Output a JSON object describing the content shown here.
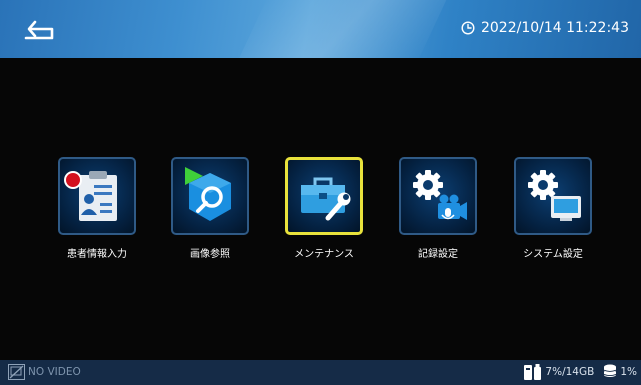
{
  "header": {
    "datetime": "2022/10/14 11:22:43",
    "back_icon": "back-arrow-icon",
    "clock_icon": "clock-icon"
  },
  "menu": {
    "items": [
      {
        "label": "患者情報入力",
        "icon": "patient-info-icon"
      },
      {
        "label": "画像参照",
        "icon": "image-search-icon"
      },
      {
        "label": "メンテナンス",
        "icon": "toolbox-icon",
        "selected": true
      },
      {
        "label": "記録設定",
        "icon": "recording-settings-icon"
      },
      {
        "label": "システム設定",
        "icon": "system-settings-icon"
      }
    ]
  },
  "statusbar": {
    "video_status": "NO VIDEO",
    "usb_storage": "7%/14GB",
    "disk_usage": "1%"
  },
  "colors": {
    "header": "#3e8fd0",
    "background": "#060606",
    "statusbar": "#152b47",
    "selected_border": "#e8e23c",
    "tile_border": "#2f5a86"
  }
}
